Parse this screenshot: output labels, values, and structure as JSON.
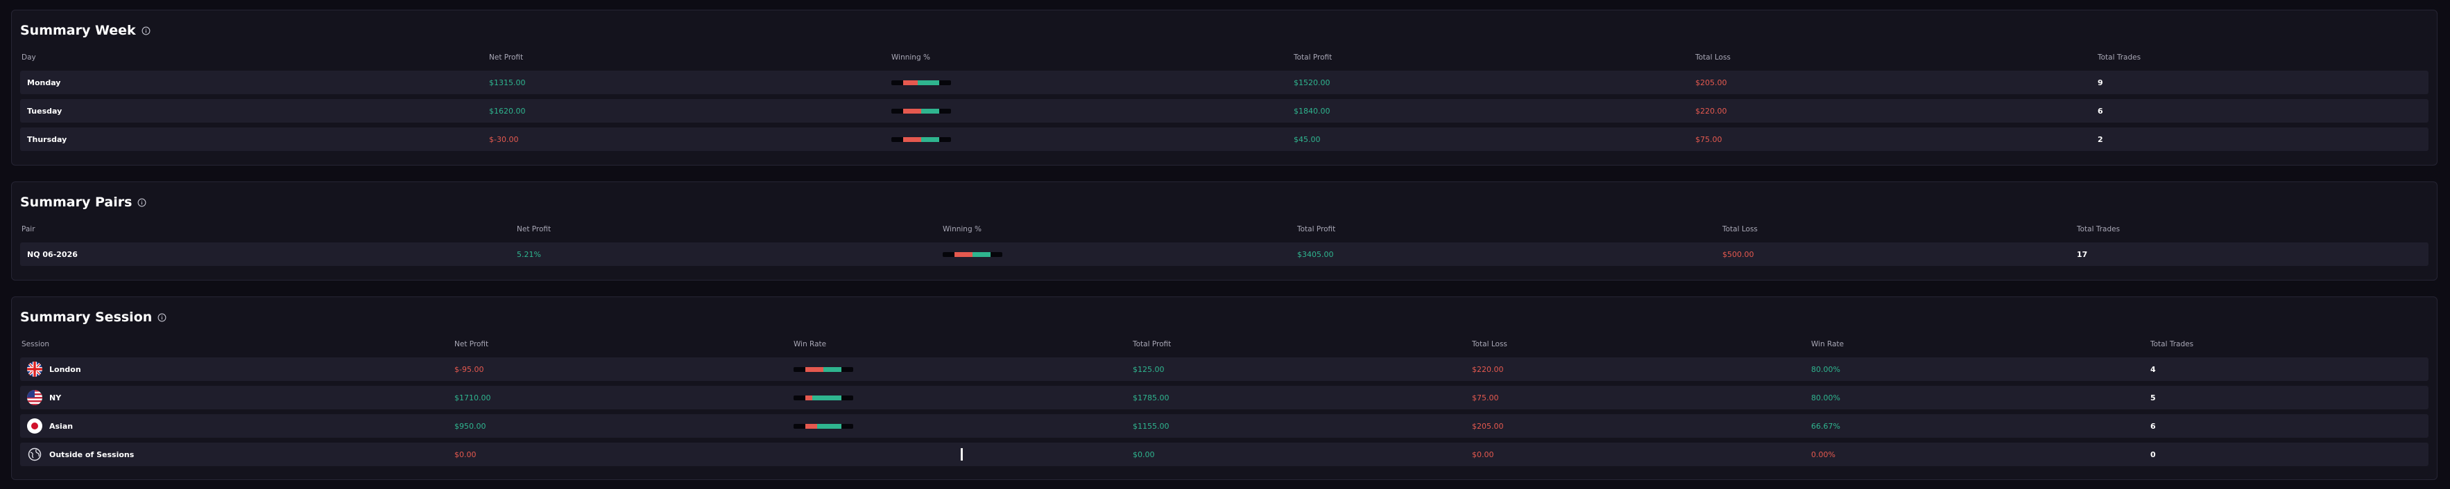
{
  "colors": {
    "positive": "#2fb58f",
    "negative": "#e5594f",
    "background": "#0d0c14",
    "card": "#14131d",
    "row": "#1f1e2c"
  },
  "week": {
    "title": "Summary Week",
    "headers": [
      "Day",
      "Net Profit",
      "Winning %",
      "Total Profit",
      "Total Loss",
      "Total Trades"
    ],
    "rows": [
      {
        "day": "Monday",
        "net": "$1315.00",
        "win": 0.6,
        "profit": "$1520.00",
        "loss": "$205.00",
        "trades": "9"
      },
      {
        "day": "Tuesday",
        "net": "$1620.00",
        "win": 0.5,
        "profit": "$1840.00",
        "loss": "$220.00",
        "trades": "6"
      },
      {
        "day": "Thursday",
        "net": "$-30.00",
        "win": 0.5,
        "profit": "$45.00",
        "loss": "$75.00",
        "trades": "2"
      }
    ]
  },
  "pairs": {
    "title": "Summary Pairs",
    "headers": [
      "Pair",
      "Net Profit",
      "Winning %",
      "Total Profit",
      "Total Loss",
      "Total Trades"
    ],
    "rows": [
      {
        "pair": "NQ 06-2026",
        "net": "5.21%",
        "win": 0.5,
        "profit": "$3405.00",
        "loss": "$500.00",
        "trades": "17"
      }
    ]
  },
  "session": {
    "title": "Summary Session",
    "headers": [
      "Session",
      "Net Profit",
      "Win Rate",
      "Total Profit",
      "Total Loss",
      "Win Rate",
      "Total Trades"
    ],
    "rows": [
      {
        "name": "London",
        "icon": "uk-flag-icon",
        "net": "$-95.00",
        "win": 0.5,
        "profit": "$125.00",
        "loss": "$220.00",
        "rate": "80.00%",
        "trades": "4"
      },
      {
        "name": "NY",
        "icon": "us-flag-icon",
        "net": "$1710.00",
        "win": 0.8,
        "profit": "$1785.00",
        "loss": "$75.00",
        "rate": "80.00%",
        "trades": "5"
      },
      {
        "name": "Asian",
        "icon": "japan-flag-icon",
        "net": "$950.00",
        "win": 0.67,
        "profit": "$1155.00",
        "loss": "$205.00",
        "rate": "66.67%",
        "trades": "6"
      },
      {
        "name": "Outside of Sessions",
        "icon": "globe-icon",
        "net": "$0.00",
        "win": 0,
        "profit": "$0.00",
        "loss": "$0.00",
        "rate": "0.00%",
        "trades": "0"
      }
    ]
  }
}
